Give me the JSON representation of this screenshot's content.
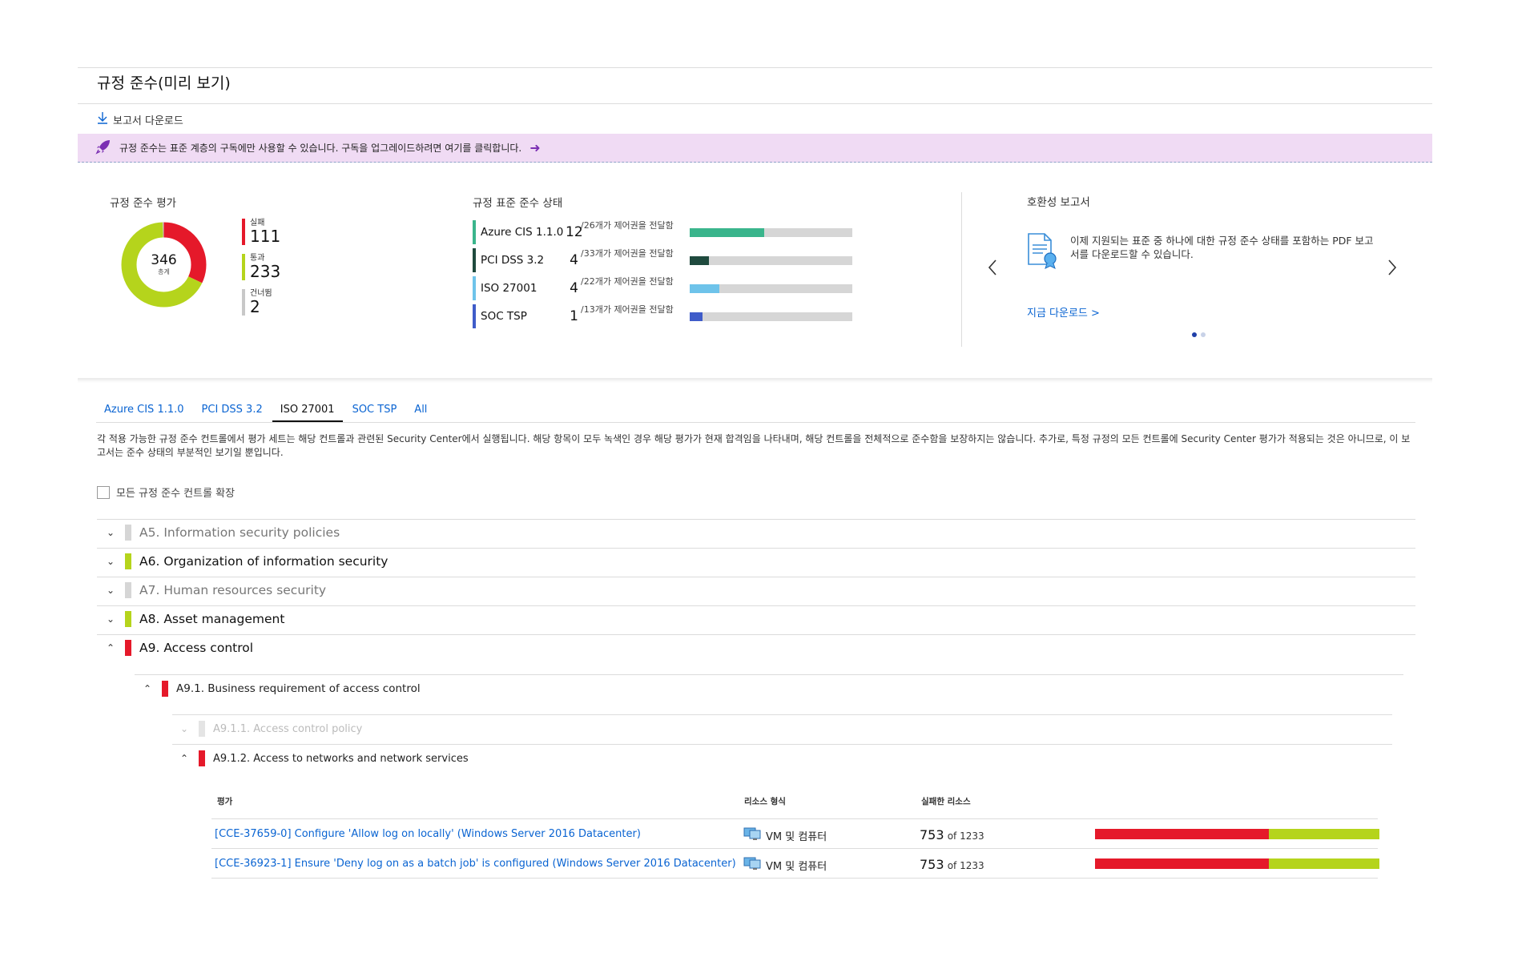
{
  "header": {
    "title": "규정 준수(미리 보기)",
    "download_report": "보고서 다운로드"
  },
  "banner": {
    "text": "규정 준수는 표준 계층의 구독에만 사용할 수 있습니다. 구독을 업그레이드하려면 여기를 클릭합니다.",
    "arrow": "➜"
  },
  "assessment": {
    "title": "규정 준수 평가",
    "total": "346",
    "total_label": "총계",
    "legend": [
      {
        "label": "실패",
        "value": "111",
        "color": "#e5192a"
      },
      {
        "label": "통과",
        "value": "233",
        "color": "#b5d41c"
      },
      {
        "label": "건너뜀",
        "value": "2",
        "color": "#c8c8c8"
      }
    ]
  },
  "standards": {
    "title": "규정 표준 준수 상태",
    "items": [
      {
        "name": "Azure CIS 1.1.0",
        "passed": "12",
        "text": "/26개가 제어권을 전달함",
        "fraction": 0.46,
        "color": "#3ab58c"
      },
      {
        "name": "PCI DSS 3.2",
        "passed": "4",
        "text": "/33개가 제어권을 전달함",
        "fraction": 0.12,
        "color": "#1f4a3e"
      },
      {
        "name": "ISO 27001",
        "passed": "4",
        "text": "/22개가 제어권을 전달함",
        "fraction": 0.18,
        "color": "#6ec3ea"
      },
      {
        "name": "SOC TSP",
        "passed": "1",
        "text": "/13개가 제어권을 전달함",
        "fraction": 0.08,
        "color": "#3f5cc9"
      }
    ]
  },
  "compat": {
    "title": "호환성 보고서",
    "text": "이제 지원되는 표준 중 하나에 대한 규정 준수 상태를 포함하는 PDF 보고서를 다운로드할 수 있습니다.",
    "link": "지금 다운로드 >",
    "prev": "‹",
    "next": "›"
  },
  "tabs": [
    "Azure CIS 1.1.0",
    "PCI DSS 3.2",
    "ISO 27001",
    "SOC TSP",
    "All"
  ],
  "active_tab": "ISO 27001",
  "description": "각 적용 가능한 규정 준수 컨트롤에서 평가 세트는 해당 컨트롤과 관련된 Security Center에서 실행됩니다. 해당 항목이 모두 녹색인 경우 해당 평가가 현재 합격임을 나타내며, 해당 컨트롤을 전체적으로 준수함을 보장하지는 않습니다. 추가로, 특정 규정의 모든 컨트롤에 Security Center 평가가 적용되는 것은 아니므로, 이 보고서는 준수 상태의 부분적인 보기일 뿐입니다.",
  "expand_all": "모든 규정 준수 컨트롤 확장",
  "tree": {
    "a5": "A5. Information security policies",
    "a6": "A6. Organization of information security",
    "a7": "A7. Human resources security",
    "a8": "A8. Asset management",
    "a9": "A9. Access control",
    "a91": "A9.1. Business requirement of access control",
    "a911": "A9.1.1. Access control policy",
    "a912": "A9.1.2. Access to networks and network services"
  },
  "status_colors": {
    "failed": "#e5192a",
    "passed": "#b5d41c",
    "skipped": "#d0d0d0"
  },
  "table": {
    "headers": {
      "assessment": "평가",
      "resource_type": "리소스 형식",
      "failed_resources": "실패한 리소스"
    },
    "rows": [
      {
        "assessment": "[CCE-37659-0] Configure 'Allow log on locally' (Windows Server 2016 Datacenter)",
        "resource_type": "VM 및 컴퓨터",
        "failed": "753",
        "of": "of 1233",
        "fraction": 0.61
      },
      {
        "assessment": "[CCE-36923-1] Ensure 'Deny log on as a batch job' is configured (Windows Server 2016 Datacenter)",
        "resource_type": "VM 및 컴퓨터",
        "failed": "753",
        "of": "of 1233",
        "fraction": 0.61
      }
    ]
  }
}
